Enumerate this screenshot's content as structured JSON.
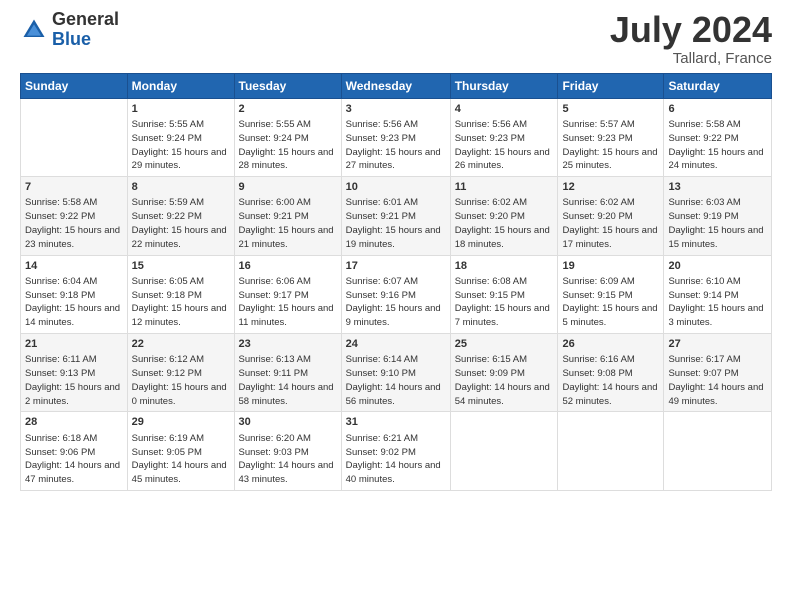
{
  "header": {
    "logo_general": "General",
    "logo_blue": "Blue",
    "main_title": "July 2024",
    "subtitle": "Tallard, France"
  },
  "days_of_week": [
    "Sunday",
    "Monday",
    "Tuesday",
    "Wednesday",
    "Thursday",
    "Friday",
    "Saturday"
  ],
  "weeks": [
    [
      {
        "day": "",
        "sunrise": "",
        "sunset": "",
        "daylight": ""
      },
      {
        "day": "1",
        "sunrise": "Sunrise: 5:55 AM",
        "sunset": "Sunset: 9:24 PM",
        "daylight": "Daylight: 15 hours and 29 minutes."
      },
      {
        "day": "2",
        "sunrise": "Sunrise: 5:55 AM",
        "sunset": "Sunset: 9:24 PM",
        "daylight": "Daylight: 15 hours and 28 minutes."
      },
      {
        "day": "3",
        "sunrise": "Sunrise: 5:56 AM",
        "sunset": "Sunset: 9:23 PM",
        "daylight": "Daylight: 15 hours and 27 minutes."
      },
      {
        "day": "4",
        "sunrise": "Sunrise: 5:56 AM",
        "sunset": "Sunset: 9:23 PM",
        "daylight": "Daylight: 15 hours and 26 minutes."
      },
      {
        "day": "5",
        "sunrise": "Sunrise: 5:57 AM",
        "sunset": "Sunset: 9:23 PM",
        "daylight": "Daylight: 15 hours and 25 minutes."
      },
      {
        "day": "6",
        "sunrise": "Sunrise: 5:58 AM",
        "sunset": "Sunset: 9:22 PM",
        "daylight": "Daylight: 15 hours and 24 minutes."
      }
    ],
    [
      {
        "day": "7",
        "sunrise": "Sunrise: 5:58 AM",
        "sunset": "Sunset: 9:22 PM",
        "daylight": "Daylight: 15 hours and 23 minutes."
      },
      {
        "day": "8",
        "sunrise": "Sunrise: 5:59 AM",
        "sunset": "Sunset: 9:22 PM",
        "daylight": "Daylight: 15 hours and 22 minutes."
      },
      {
        "day": "9",
        "sunrise": "Sunrise: 6:00 AM",
        "sunset": "Sunset: 9:21 PM",
        "daylight": "Daylight: 15 hours and 21 minutes."
      },
      {
        "day": "10",
        "sunrise": "Sunrise: 6:01 AM",
        "sunset": "Sunset: 9:21 PM",
        "daylight": "Daylight: 15 hours and 19 minutes."
      },
      {
        "day": "11",
        "sunrise": "Sunrise: 6:02 AM",
        "sunset": "Sunset: 9:20 PM",
        "daylight": "Daylight: 15 hours and 18 minutes."
      },
      {
        "day": "12",
        "sunrise": "Sunrise: 6:02 AM",
        "sunset": "Sunset: 9:20 PM",
        "daylight": "Daylight: 15 hours and 17 minutes."
      },
      {
        "day": "13",
        "sunrise": "Sunrise: 6:03 AM",
        "sunset": "Sunset: 9:19 PM",
        "daylight": "Daylight: 15 hours and 15 minutes."
      }
    ],
    [
      {
        "day": "14",
        "sunrise": "Sunrise: 6:04 AM",
        "sunset": "Sunset: 9:18 PM",
        "daylight": "Daylight: 15 hours and 14 minutes."
      },
      {
        "day": "15",
        "sunrise": "Sunrise: 6:05 AM",
        "sunset": "Sunset: 9:18 PM",
        "daylight": "Daylight: 15 hours and 12 minutes."
      },
      {
        "day": "16",
        "sunrise": "Sunrise: 6:06 AM",
        "sunset": "Sunset: 9:17 PM",
        "daylight": "Daylight: 15 hours and 11 minutes."
      },
      {
        "day": "17",
        "sunrise": "Sunrise: 6:07 AM",
        "sunset": "Sunset: 9:16 PM",
        "daylight": "Daylight: 15 hours and 9 minutes."
      },
      {
        "day": "18",
        "sunrise": "Sunrise: 6:08 AM",
        "sunset": "Sunset: 9:15 PM",
        "daylight": "Daylight: 15 hours and 7 minutes."
      },
      {
        "day": "19",
        "sunrise": "Sunrise: 6:09 AM",
        "sunset": "Sunset: 9:15 PM",
        "daylight": "Daylight: 15 hours and 5 minutes."
      },
      {
        "day": "20",
        "sunrise": "Sunrise: 6:10 AM",
        "sunset": "Sunset: 9:14 PM",
        "daylight": "Daylight: 15 hours and 3 minutes."
      }
    ],
    [
      {
        "day": "21",
        "sunrise": "Sunrise: 6:11 AM",
        "sunset": "Sunset: 9:13 PM",
        "daylight": "Daylight: 15 hours and 2 minutes."
      },
      {
        "day": "22",
        "sunrise": "Sunrise: 6:12 AM",
        "sunset": "Sunset: 9:12 PM",
        "daylight": "Daylight: 15 hours and 0 minutes."
      },
      {
        "day": "23",
        "sunrise": "Sunrise: 6:13 AM",
        "sunset": "Sunset: 9:11 PM",
        "daylight": "Daylight: 14 hours and 58 minutes."
      },
      {
        "day": "24",
        "sunrise": "Sunrise: 6:14 AM",
        "sunset": "Sunset: 9:10 PM",
        "daylight": "Daylight: 14 hours and 56 minutes."
      },
      {
        "day": "25",
        "sunrise": "Sunrise: 6:15 AM",
        "sunset": "Sunset: 9:09 PM",
        "daylight": "Daylight: 14 hours and 54 minutes."
      },
      {
        "day": "26",
        "sunrise": "Sunrise: 6:16 AM",
        "sunset": "Sunset: 9:08 PM",
        "daylight": "Daylight: 14 hours and 52 minutes."
      },
      {
        "day": "27",
        "sunrise": "Sunrise: 6:17 AM",
        "sunset": "Sunset: 9:07 PM",
        "daylight": "Daylight: 14 hours and 49 minutes."
      }
    ],
    [
      {
        "day": "28",
        "sunrise": "Sunrise: 6:18 AM",
        "sunset": "Sunset: 9:06 PM",
        "daylight": "Daylight: 14 hours and 47 minutes."
      },
      {
        "day": "29",
        "sunrise": "Sunrise: 6:19 AM",
        "sunset": "Sunset: 9:05 PM",
        "daylight": "Daylight: 14 hours and 45 minutes."
      },
      {
        "day": "30",
        "sunrise": "Sunrise: 6:20 AM",
        "sunset": "Sunset: 9:03 PM",
        "daylight": "Daylight: 14 hours and 43 minutes."
      },
      {
        "day": "31",
        "sunrise": "Sunrise: 6:21 AM",
        "sunset": "Sunset: 9:02 PM",
        "daylight": "Daylight: 14 hours and 40 minutes."
      },
      {
        "day": "",
        "sunrise": "",
        "sunset": "",
        "daylight": ""
      },
      {
        "day": "",
        "sunrise": "",
        "sunset": "",
        "daylight": ""
      },
      {
        "day": "",
        "sunrise": "",
        "sunset": "",
        "daylight": ""
      }
    ]
  ]
}
